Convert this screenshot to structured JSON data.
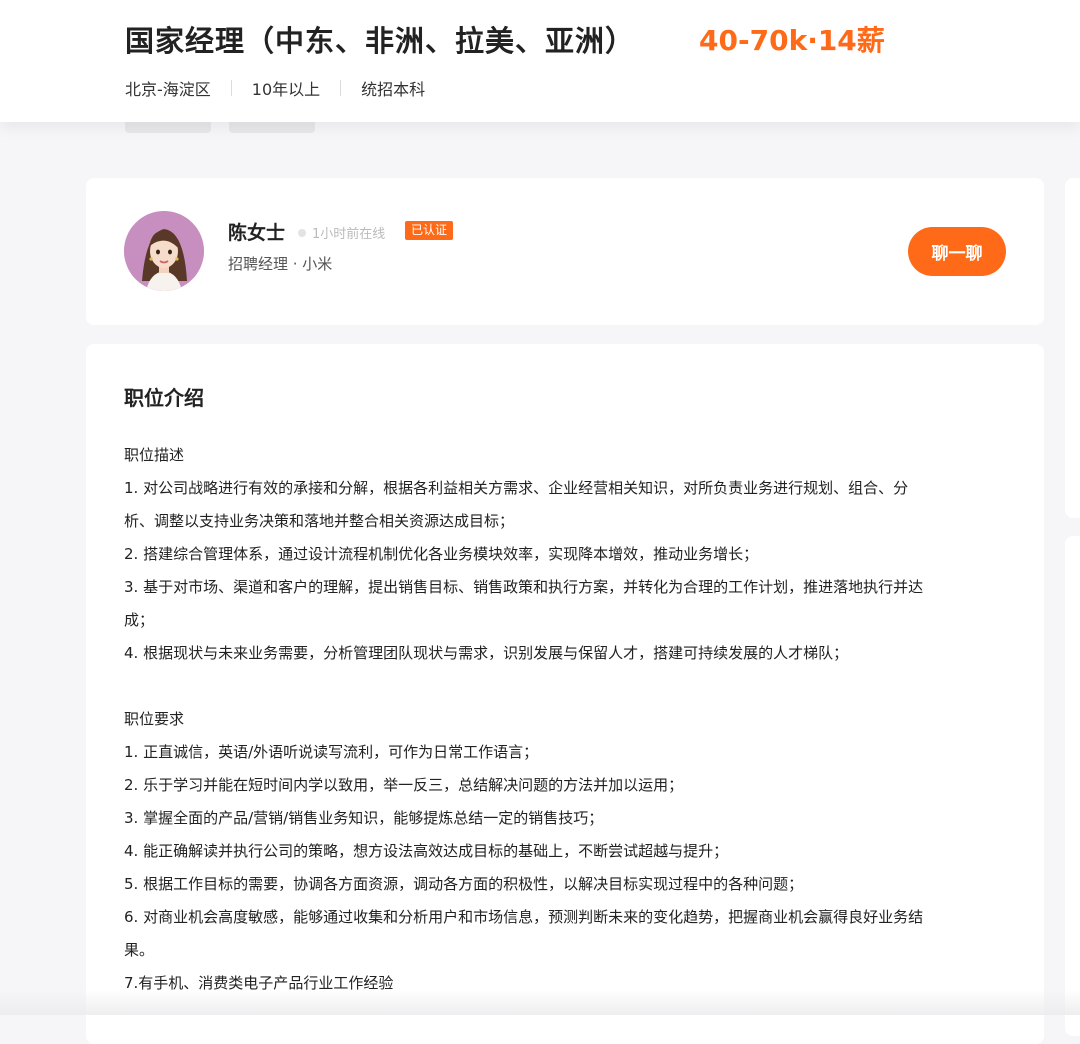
{
  "header": {
    "job_title": "国家经理（中东、非洲、拉美、亚洲）",
    "salary": "40-70k·14薪",
    "meta": [
      "北京-海淀区",
      "10年以上",
      "统招本科"
    ]
  },
  "recruiter": {
    "name": "陈女士",
    "online_status": "1小时前在线",
    "verified_badge": "已认证",
    "role": "招聘经理 · 小米",
    "chat_button": "聊一聊"
  },
  "job_intro": {
    "section_title": "职位介绍",
    "lines": [
      "职位描述",
      "1. 对公司战略进行有效的承接和分解，根据各利益相关方需求、企业经营相关知识，对所负责业务进行规划、组合、分",
      "析、调整以支持业务决策和落地并整合相关资源达成目标；",
      "2. 搭建综合管理体系，通过设计流程机制优化各业务模块效率，实现降本增效，推动业务增长；",
      "3. 基于对市场、渠道和客户的理解，提出销售目标、销售政策和执行方案，并转化为合理的工作计划，推进落地执行并达",
      "成；",
      "4. 根据现状与未来业务需要，分析管理团队现状与需求，识别发展与保留人才，搭建可持续发展的人才梯队；",
      "",
      "职位要求",
      "1. 正直诚信，英语/外语听说读写流利，可作为日常工作语言；",
      "2. 乐于学习并能在短时间内学以致用，举一反三，总结解决问题的方法并加以运用；",
      "3. 掌握全面的产品/营销/销售业务知识，能够提炼总结一定的销售技巧；",
      "4. 能正确解读并执行公司的策略，想方设法高效达成目标的基础上，不断尝试超越与提升；",
      "5. 根据工作目标的需要，协调各方面资源，调动各方面的积极性，以解决目标实现过程中的各种问题；",
      "6. 对商业机会高度敏感，能够通过收集和分析用户和市场信息，预测判断未来的变化趋势，把握商业机会赢得良好业务结",
      "果。",
      "7.有手机、消费类电子产品行业工作经验"
    ]
  },
  "colors": {
    "accent": "#fe6a18",
    "page_background": "#f6f6f8",
    "card_background": "#ffffff",
    "avatar_background": "#c78fbf"
  }
}
